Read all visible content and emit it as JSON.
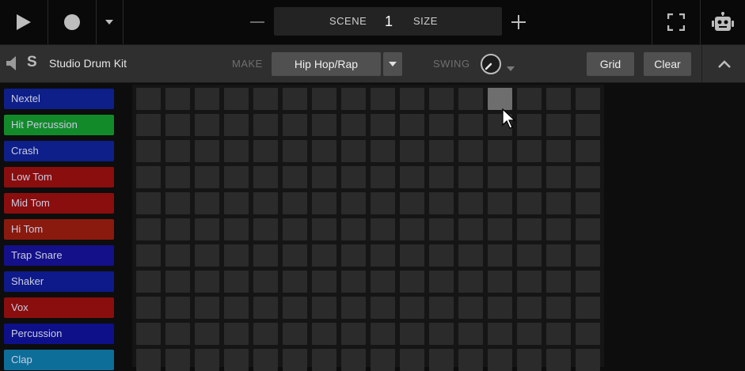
{
  "transport": {
    "play_icon": "play-icon",
    "record_icon": "record-icon",
    "scene_label": "SCENE",
    "scene_value": "1",
    "size_label": "SIZE",
    "minus_icon": "minus-icon",
    "plus_icon": "plus-icon",
    "fullscreen_icon": "fullscreen-icon",
    "robot_icon": "robot-icon"
  },
  "kitbar": {
    "solo_label": "S",
    "kit_name": "Studio Drum Kit",
    "make_label": "MAKE",
    "genre_value": "Hip Hop/Rap",
    "swing_label": "SWING",
    "grid_label": "Grid",
    "clear_label": "Clear"
  },
  "tracks": [
    {
      "label": "Nextel",
      "color": "#0e1f8a"
    },
    {
      "label": "Hit Percussion",
      "color": "#128a2a"
    },
    {
      "label": "Crash",
      "color": "#0e1f8a"
    },
    {
      "label": "Low Tom",
      "color": "#8a0e0e"
    },
    {
      "label": "Mid Tom",
      "color": "#8a0e0e"
    },
    {
      "label": "Hi Tom",
      "color": "#8a1a0e"
    },
    {
      "label": "Trap Snare",
      "color": "#14108a"
    },
    {
      "label": "Shaker",
      "color": "#0e1a8a"
    },
    {
      "label": "Vox",
      "color": "#8a0e0e"
    },
    {
      "label": "Percussion",
      "color": "#0e108a"
    },
    {
      "label": "Clap",
      "color": "#0e6e9a"
    }
  ],
  "grid": {
    "columns": 16,
    "rows": 11,
    "active_cells": [
      [
        0,
        12
      ]
    ]
  },
  "colors": {
    "background": "#0d0d0d",
    "pad_off": "#2b2b2b",
    "pad_on": "#6e6e6e",
    "button": "#505050"
  }
}
